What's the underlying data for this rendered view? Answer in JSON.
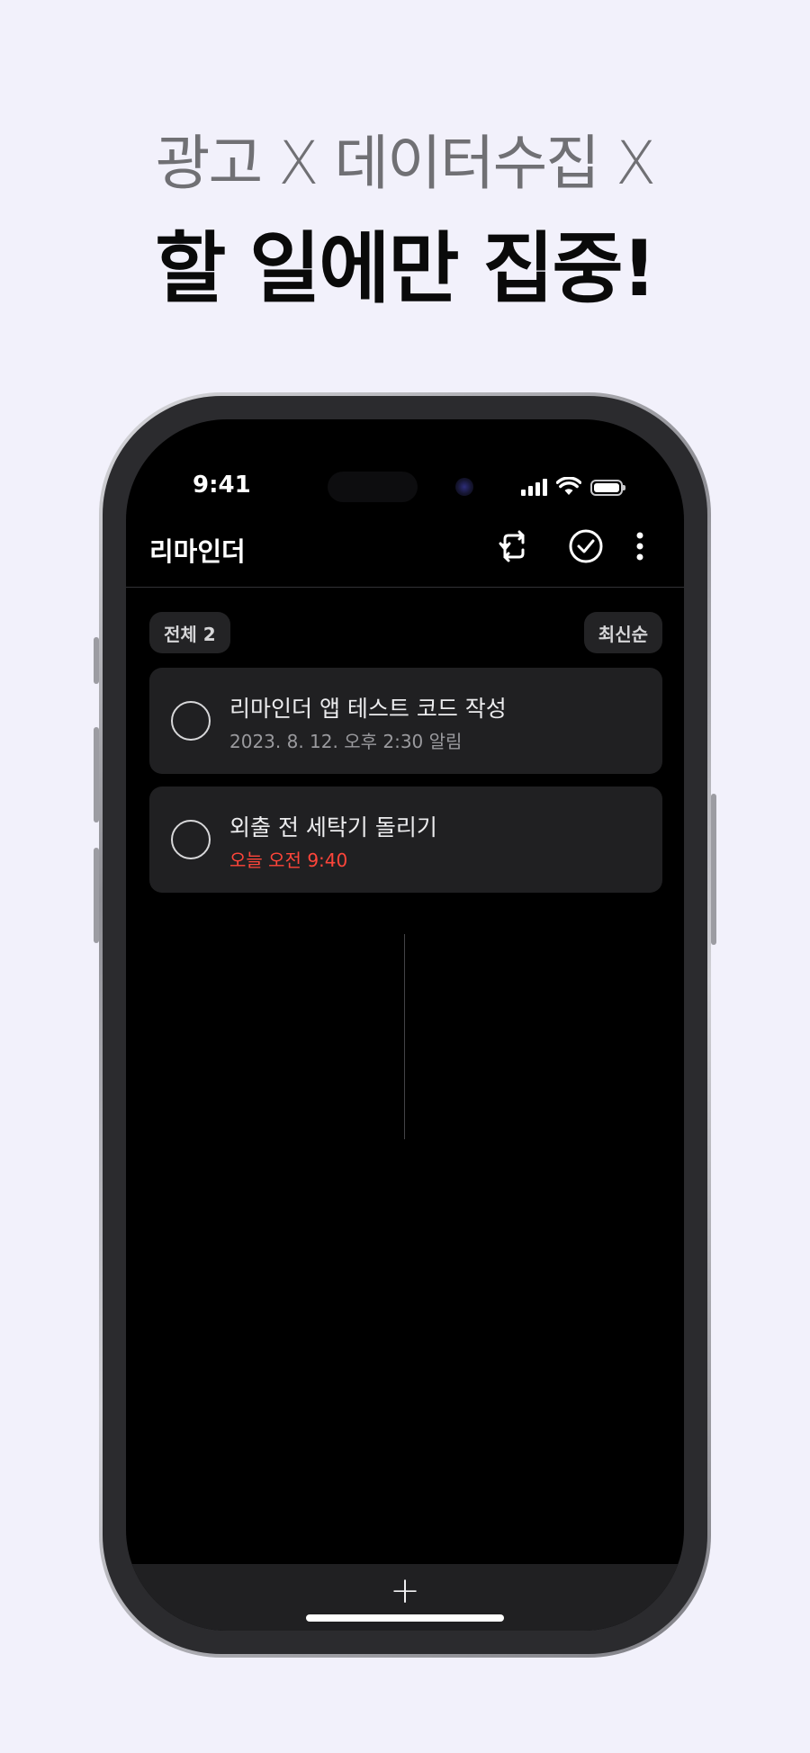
{
  "promo": {
    "subtitle": "광고 X 데이터수집 X",
    "headline": "할 일에만 집중!"
  },
  "status_bar": {
    "time": "9:41",
    "icons": [
      "cellular-signal-icon",
      "wifi-icon",
      "battery-icon"
    ]
  },
  "header": {
    "title": "리마인더",
    "actions": [
      "sync-icon",
      "check-circle-icon",
      "more-vertical-icon"
    ]
  },
  "filter": {
    "count_label": "전체 2",
    "sort_label": "최신순"
  },
  "reminders": [
    {
      "title": "리마인더 앱 테스트 코드 작성",
      "subtitle": "2023. 8. 12. 오후 2:30 알림",
      "overdue": false
    },
    {
      "title": "외출 전 세탁기 돌리기",
      "subtitle": "오늘 오전 9:40",
      "overdue": true
    }
  ],
  "bottom": {
    "add_label": "+"
  },
  "colors": {
    "background": "#f2f1fb",
    "screen": "#000000",
    "card": "#202022",
    "accent_red": "#ff453a"
  }
}
